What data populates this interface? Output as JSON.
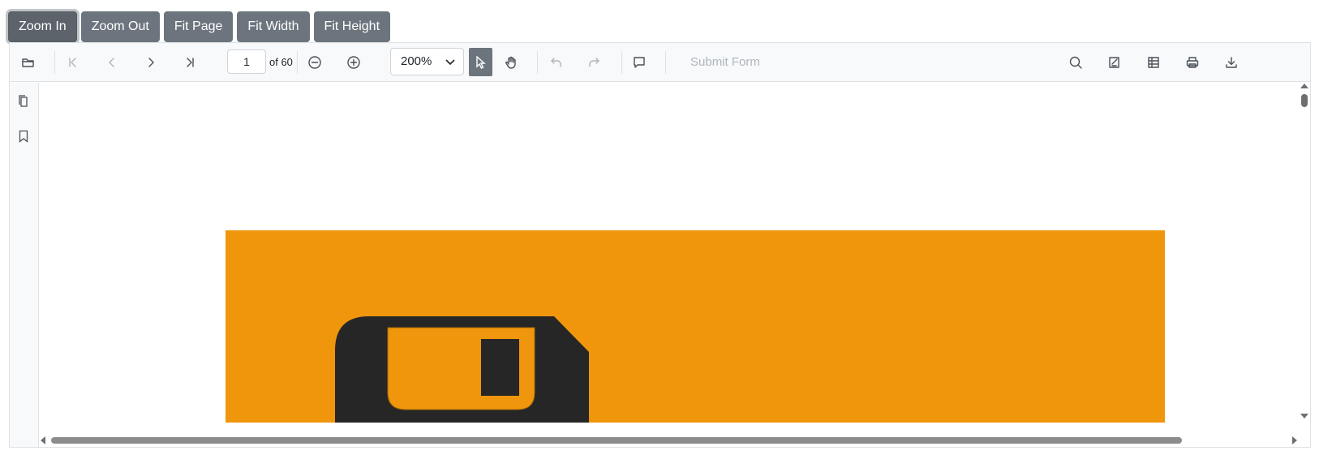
{
  "buttons": {
    "zoom_in": "Zoom In",
    "zoom_out": "Zoom Out",
    "fit_page": "Fit Page",
    "fit_width": "Fit Width",
    "fit_height": "Fit Height"
  },
  "toolbar": {
    "current_page": "1",
    "total_pages": "of 60",
    "zoom_value": "200%",
    "submit_form": "Submit Form"
  },
  "icons": {
    "open": "folder-open-icon",
    "first_page": "first-page-icon",
    "prev_page": "previous-page-icon",
    "next_page": "next-page-icon",
    "last_page": "last-page-icon",
    "zoom_out": "zoom-out-icon",
    "zoom_in": "zoom-in-icon",
    "select": "text-select-cursor-icon",
    "pan": "hand-pan-icon",
    "undo": "undo-icon",
    "redo": "redo-icon",
    "comment": "comment-icon",
    "search": "search-icon",
    "annotation": "edit-annotation-icon",
    "form_designer": "form-designer-icon",
    "print": "print-icon",
    "download": "download-icon",
    "page_thumbnails": "page-thumbnails-icon",
    "bookmarks": "bookmark-icon"
  },
  "colors": {
    "page_background": "#ef960c",
    "disk_dark": "#262626",
    "button_bg": "#6c757d"
  }
}
